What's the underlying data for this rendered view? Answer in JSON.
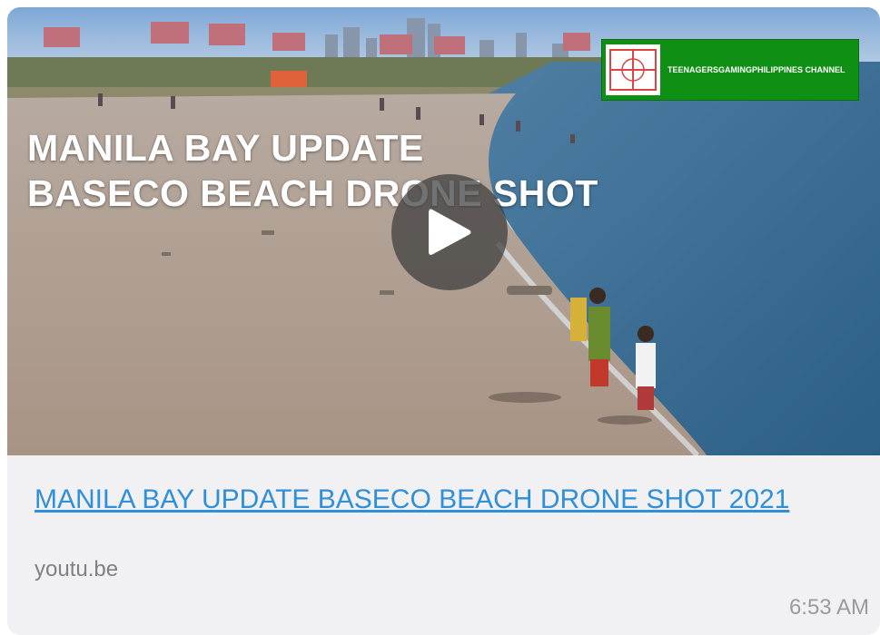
{
  "video": {
    "overlay_title_line1": "MANILA BAY UPDATE",
    "overlay_title_line2": "BASECO BEACH DRONE SHOT",
    "channel_name": "TEENAGERSGAMINGPHILIPPINES CHANNEL",
    "play_icon": "play-icon"
  },
  "link": {
    "title": "MANILA BAY UPDATE BASECO BEACH DRONE SHOT 2021",
    "domain": "youtu.be"
  },
  "message": {
    "timestamp": "6:53 AM"
  },
  "colors": {
    "link": "#2f8fd8",
    "card_bg": "#f1f1f3",
    "badge": "#0f8f14"
  }
}
